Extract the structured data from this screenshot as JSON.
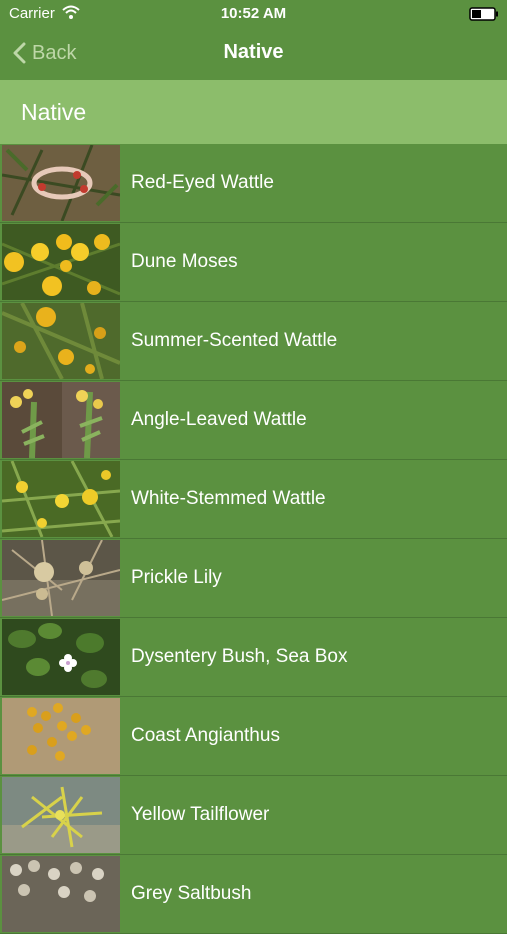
{
  "status": {
    "carrier": "Carrier",
    "time": "10:52 AM"
  },
  "nav": {
    "back_label": "Back",
    "title": "Native"
  },
  "section": {
    "title": "Native"
  },
  "items": [
    {
      "label": "Red-Eyed Wattle",
      "thumb": "red-eyed-wattle-photo"
    },
    {
      "label": "Dune Moses",
      "thumb": "dune-moses-photo"
    },
    {
      "label": "Summer-Scented Wattle",
      "thumb": "summer-scented-wattle-photo"
    },
    {
      "label": "Angle-Leaved Wattle",
      "thumb": "angle-leaved-wattle-photo"
    },
    {
      "label": "White-Stemmed Wattle",
      "thumb": "white-stemmed-wattle-photo"
    },
    {
      "label": "Prickle Lily",
      "thumb": "prickle-lily-photo"
    },
    {
      "label": "Dysentery Bush, Sea Box",
      "thumb": "dysentery-bush-photo"
    },
    {
      "label": "Coast Angianthus",
      "thumb": "coast-angianthus-photo"
    },
    {
      "label": "Yellow Tailflower",
      "thumb": "yellow-tailflower-photo"
    },
    {
      "label": "Grey Saltbush",
      "thumb": "grey-saltbush-photo"
    }
  ],
  "colors": {
    "primary": "#5b9140",
    "section": "#8cbd6b",
    "back": "#bed7a8"
  }
}
